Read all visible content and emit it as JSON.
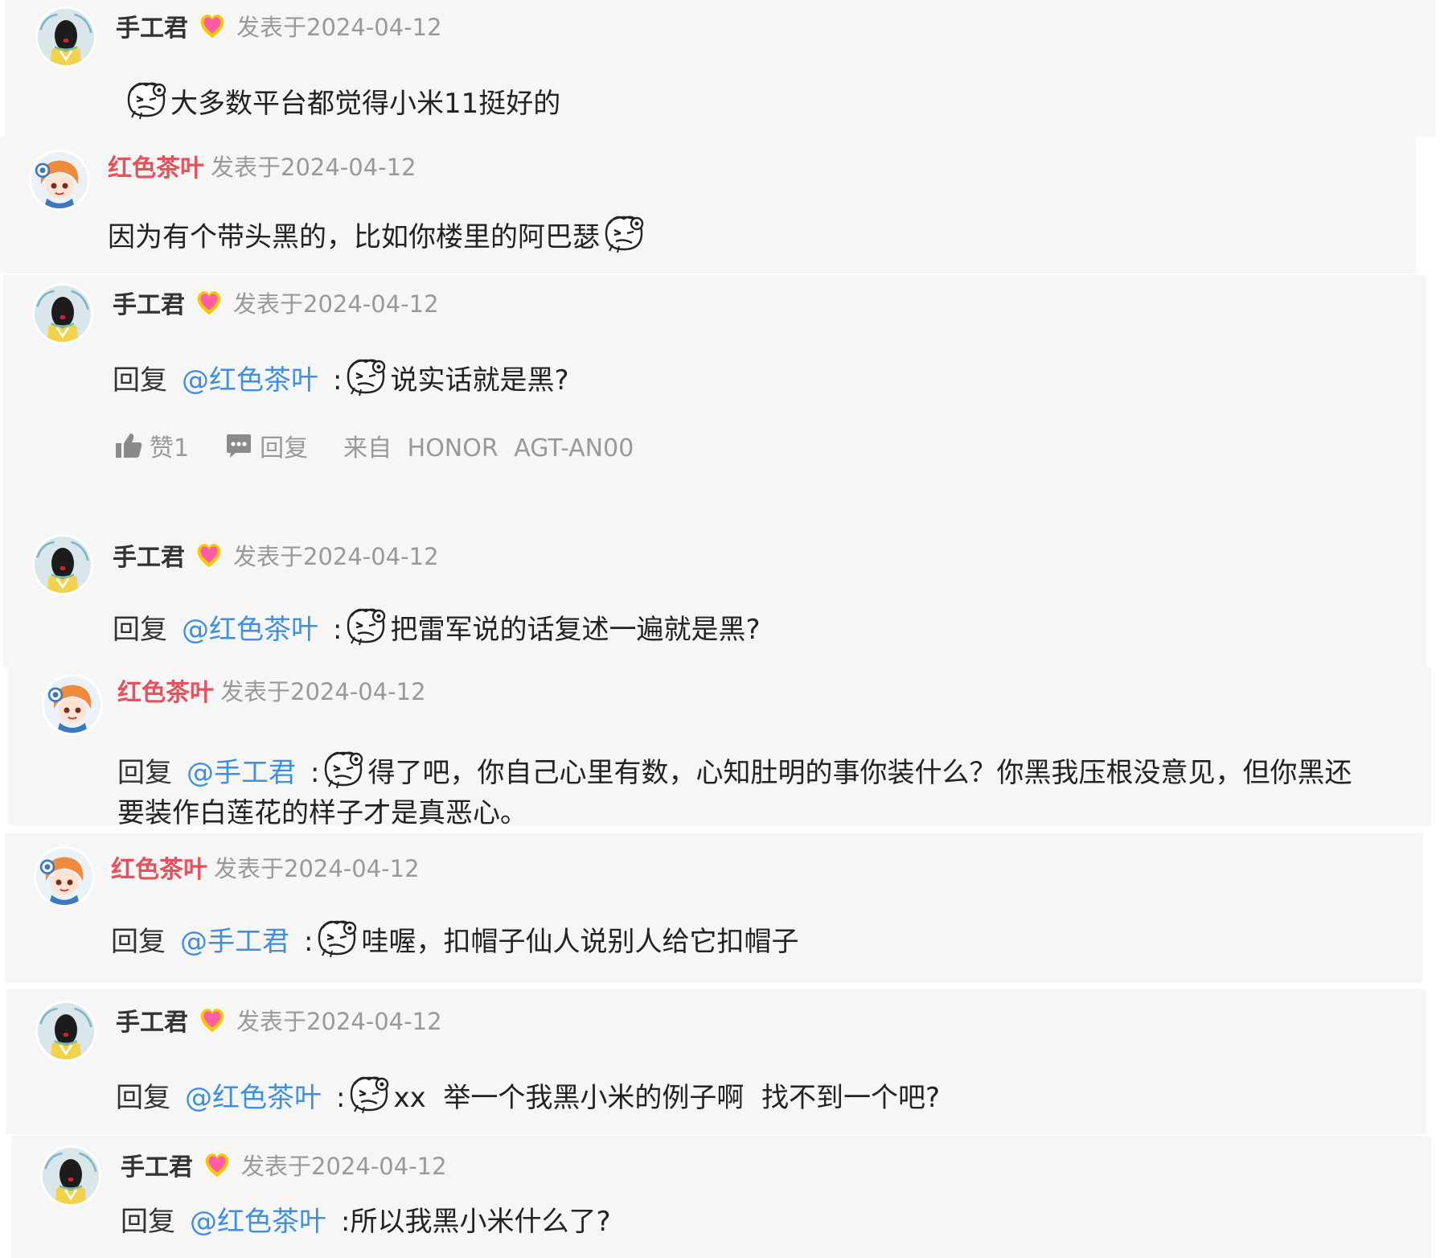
{
  "colors": {
    "card_bg": "#f6f6f6",
    "username_red": "#e8505b",
    "mention_blue": "#3f8ee0",
    "meta_gray": "#999999"
  },
  "icons": {
    "badge": "heart-badge-icon",
    "emoji": "doodle-face-emoji-icon",
    "like": "thumbs-up-icon",
    "reply": "chat-bubble-icon"
  },
  "posts": [
    {
      "user": "手工君",
      "date": "发表于2024-04-12",
      "text": "大多数平台都觉得小米11挺好的"
    },
    {
      "user": "红色茶叶",
      "date": "发表于2024-04-12",
      "text": "因为有个带头黑的，比如你楼里的阿巴瑟"
    },
    {
      "user": "手工君",
      "date": "发表于2024-04-12",
      "reply_word": "回复",
      "mention": "@红色茶叶",
      "colon": ":",
      "text": "说实话就是黑?",
      "like_label": "赞1",
      "reply_label": "回复",
      "device": "来自 HONOR AGT-AN00"
    },
    {
      "user": "手工君",
      "date": "发表于2024-04-12",
      "reply_word": "回复",
      "mention": "@红色茶叶",
      "colon": ":",
      "text": "把雷军说的话复述一遍就是黑?"
    },
    {
      "user": "红色茶叶",
      "date": "发表于2024-04-12",
      "reply_word": "回复",
      "mention": "@手工君",
      "colon": ":",
      "text_line1": "得了吧，你自己心里有数，心知肚明的事你装什么？你黑我压根没意见，但你黑还",
      "text_line2": "要装作白莲花的样子才是真恶心。"
    },
    {
      "user": "红色茶叶",
      "date": "发表于2024-04-12",
      "reply_word": "回复",
      "mention": "@手工君",
      "colon": ":",
      "text": "哇喔，扣帽子仙人说别人给它扣帽子"
    },
    {
      "user": "手工君",
      "date": "发表于2024-04-12",
      "reply_word": "回复",
      "mention": "@红色茶叶",
      "colon": ":",
      "text": "xx  举一个我黑小米的例子啊  找不到一个吧?"
    },
    {
      "user": "手工君",
      "date": "发表于2024-04-12",
      "reply_word": "回复",
      "mention": "@红色茶叶",
      "text": ":所以我黑小米什么了?"
    }
  ]
}
